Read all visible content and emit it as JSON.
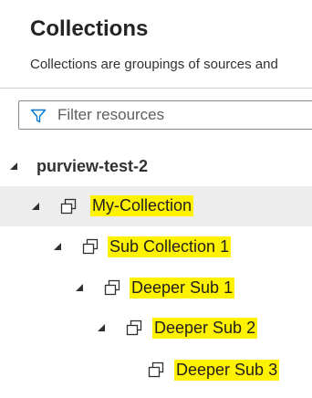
{
  "header": {
    "title": "Collections",
    "subtitle": "Collections are groupings of sources and"
  },
  "filter": {
    "placeholder": "Filter resources",
    "icon": "filter-icon"
  },
  "tree": {
    "root": {
      "label": "purview-test-2",
      "icon": "caret-down-icon"
    },
    "nodes": [
      {
        "label": "My-Collection",
        "selected": true,
        "highlighted": true
      },
      {
        "label": "Sub Collection 1",
        "highlighted": true
      },
      {
        "label": "Deeper Sub 1",
        "highlighted": true
      },
      {
        "label": "Deeper Sub 2",
        "highlighted": true
      },
      {
        "label": "Deeper Sub 3",
        "highlighted": true
      }
    ]
  },
  "colors": {
    "highlight": "#fff200",
    "selected_row": "#ededed",
    "filter_icon": "#0078d4"
  }
}
